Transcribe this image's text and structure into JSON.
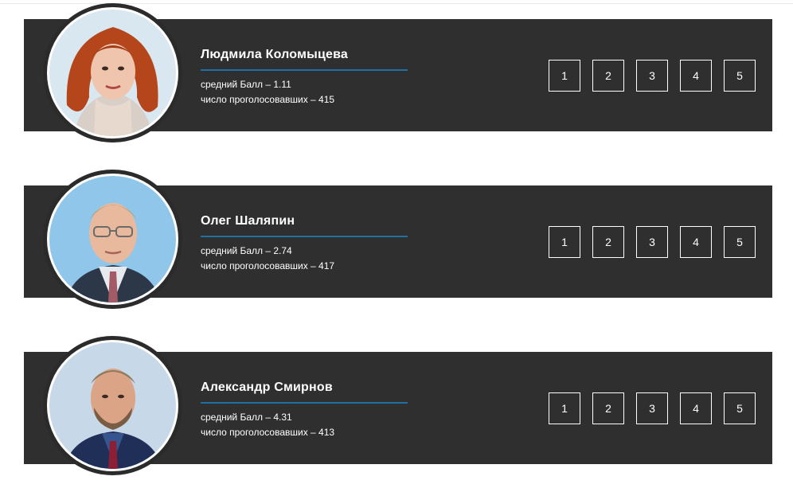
{
  "candidates": [
    {
      "name": "Людмила Коломыцева",
      "average": "средний Балл – 1.11",
      "votes": "число проголосовавших – 415",
      "photo": "portrait-woman-red-hair"
    },
    {
      "name": "Олег Шаляпин",
      "average": "средний Балл – 2.74",
      "votes": "число проголосовавших – 417",
      "photo": "portrait-man-glasses"
    },
    {
      "name": "Александр Смирнов",
      "average": "средний Балл – 4.31",
      "votes": "число проголосовавших – 413",
      "photo": "portrait-man-beard"
    }
  ],
  "rating_options": [
    "1",
    "2",
    "3",
    "4",
    "5"
  ],
  "colors": {
    "card_background": "#2f2f2f",
    "accent_rule": "#1f6fa3",
    "text": "#ffffff"
  }
}
